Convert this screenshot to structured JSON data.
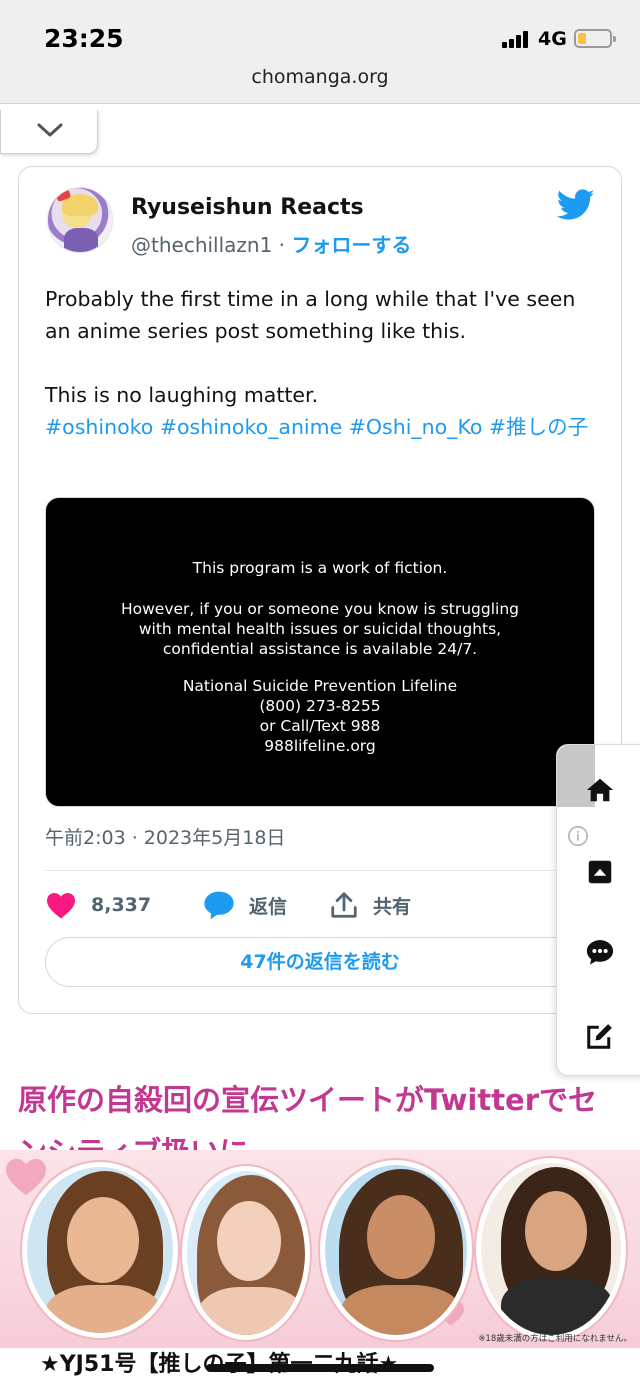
{
  "status_bar": {
    "time": "23:25",
    "network": "4G",
    "battery_level": 0.2,
    "signal_bars": 4
  },
  "browser": {
    "url": "chomanga.org"
  },
  "tweet": {
    "display_name": "Ryuseishun Reacts",
    "handle": "@thechillazn1",
    "separator": " · ",
    "follow_label": "フォローする",
    "text_line1": "Probably the first time in a long while that I've seen an anime series post something like this.",
    "text_line2": "This is no laughing matter.",
    "hashtags": "#oshinoko #oshinoko_anime #Oshi_no_Ko #推しの子",
    "media_text": {
      "line1": "This program is a work of fiction.",
      "line2": "However, if you or someone you know is struggling",
      "line3": "with mental health issues or suicidal thoughts,",
      "line4": "confidential assistance is available 24/7.",
      "line5": "National Suicide Prevention Lifeline",
      "line6": "(800) 273-8255",
      "line7": "or Call/Text 988",
      "line8": "988lifeline.org"
    },
    "timestamp": "午前2:03 · 2023年5月18日",
    "like_count": "8,337",
    "reply_label": "返信",
    "share_label": "共有",
    "read_replies_label": "47件の返信を読む"
  },
  "article": {
    "heading": "原作の自殺回の宣伝ツイートがTwitterでセンシティブ扱いに"
  },
  "ad": {
    "note": "※18歳未満の方はご利用になれません。"
  },
  "bottom": {
    "text": "★YJ51号【推しの子】第一二九話★"
  },
  "colors": {
    "accent": "#1d9bf0",
    "like": "#f91880",
    "heading": "#c2378f"
  },
  "icons": [
    "chevron-down-icon",
    "twitter-bird-icon",
    "heart-icon",
    "reply-bubble-icon",
    "share-icon",
    "home-icon",
    "info-icon",
    "scroll-top-icon",
    "comment-icon",
    "edit-icon"
  ]
}
